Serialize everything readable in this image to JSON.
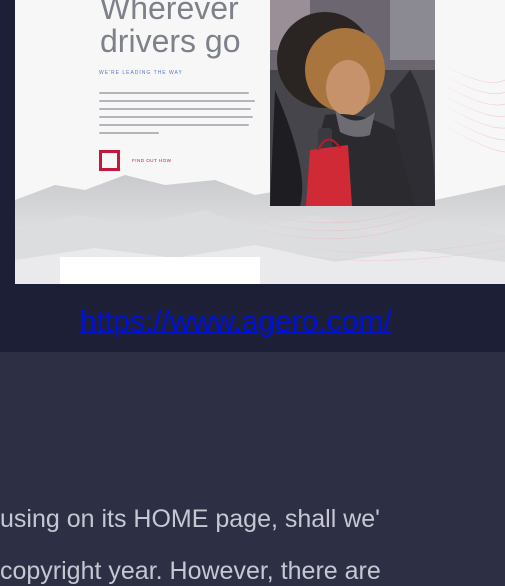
{
  "preview": {
    "headline_line1": "Wherever",
    "headline_line2": "drivers go",
    "tagline": "WE'RE LEADING THE WAY",
    "cta_label": "FIND OUT HOW"
  },
  "link": {
    "text": "https://www.agero.com/"
  },
  "paragraph": {
    "line1": "using on its HOME page, shall we'",
    "line2": "copyright year. However, there are"
  },
  "colors": {
    "page_background": "#2d2f45",
    "top_band": "#1d1f37",
    "link": "#0011d6",
    "accent_red": "#c3183e",
    "text": "#c5c7d2"
  }
}
